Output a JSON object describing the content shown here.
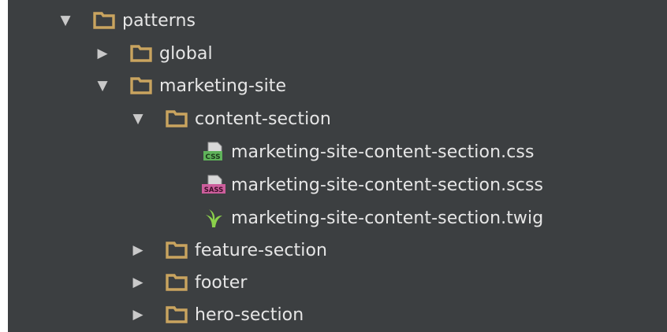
{
  "tree": {
    "patterns": {
      "label": "patterns",
      "expanded": true
    },
    "global": {
      "label": "global",
      "expanded": false
    },
    "marketing_site": {
      "label": "marketing-site",
      "expanded": true
    },
    "content_section": {
      "label": "content-section",
      "expanded": true
    },
    "files": [
      {
        "label": "marketing-site-content-section.css",
        "icon": "css-file-icon",
        "badge": "CSS",
        "badge_color": "#5fb35a"
      },
      {
        "label": "marketing-site-content-section.scss",
        "icon": "sass-file-icon",
        "badge": "SASS",
        "badge_color": "#cd5e9c"
      },
      {
        "label": "marketing-site-content-section.twig",
        "icon": "twig-file-icon",
        "badge_color": "#8bd14b"
      }
    ],
    "feature_section": {
      "label": "feature-section",
      "expanded": false
    },
    "footer": {
      "label": "footer",
      "expanded": false
    },
    "hero_section": {
      "label": "hero-section",
      "expanded": false
    }
  },
  "colors": {
    "background": "#3c3f41",
    "text": "#e6e6e6",
    "folder": "#c9a45f",
    "arrow": "#c9c9c9"
  }
}
